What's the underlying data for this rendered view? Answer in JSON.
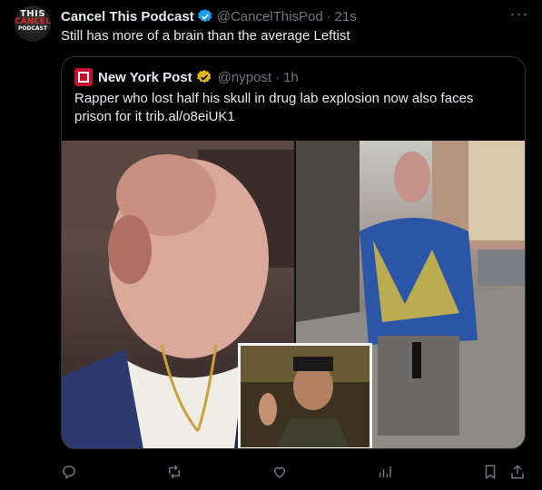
{
  "tweet": {
    "name": "Cancel This Podcast",
    "handle": "@CancelThisPod",
    "separator": "·",
    "time": "21s",
    "text": "Still has more of a brain than the average Leftist",
    "avatar_lines": [
      "THIS",
      "CANCEL",
      "PODCAST"
    ],
    "verified_icon": "verified-blue-badge",
    "more_icon": "more-horizontal-icon"
  },
  "quote": {
    "name": "New York Post",
    "handle": "@nypost",
    "separator": "·",
    "time": "1h",
    "text": "Rapper who lost half his skull in drug lab explosion now also faces prison for it trib.al/o8eiUK1",
    "verified_icon": "verified-gold-badge",
    "logo_icon": "nypost-logo-icon"
  },
  "actions": [
    "reply-icon",
    "retweet-icon",
    "like-icon",
    "views-icon",
    "bookmark-icon",
    "share-icon"
  ],
  "colors": {
    "background": "#000000",
    "text": "#e7e9ea",
    "muted": "#71767b",
    "border": "#2f3336",
    "blue_check": "#1d9bf0",
    "gold_check": "#e2b719",
    "nypost_red": "#c8102e"
  }
}
